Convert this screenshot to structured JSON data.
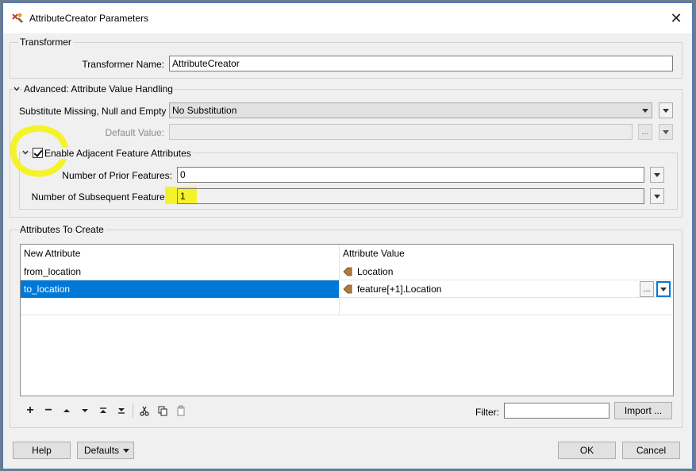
{
  "window": {
    "title": "AttributeCreator Parameters",
    "close_glyph": "✕"
  },
  "transformer": {
    "group_title": "Transformer",
    "name_label": "Transformer Name:",
    "name_value": "AttributeCreator"
  },
  "advanced": {
    "group_title": "Advanced: Attribute Value Handling",
    "substitute_label": "Substitute Missing, Null and Empty by:",
    "substitute_value": "No Substitution",
    "default_label": "Default Value:",
    "default_value": "",
    "ellipsis": "...",
    "adjacent": {
      "checkbox_label": "Enable Adjacent Feature Attributes",
      "checked": true,
      "prior_label": "Number of Prior Features:",
      "prior_value": "0",
      "subsequent_label": "Number of Subsequent Features:",
      "subsequent_value": "1"
    }
  },
  "attributes": {
    "group_title": "Attributes To Create",
    "columns": [
      "New Attribute",
      "Attribute Value"
    ],
    "rows": [
      {
        "name": "from_location",
        "value": "Location"
      },
      {
        "name": "to_location",
        "value": "feature[+1].Location"
      }
    ],
    "cell_ellipsis": "...",
    "selected_row": 1
  },
  "toolbar": {
    "filter_label": "Filter:",
    "filter_value": "",
    "import_label": "Import ...",
    "tools": [
      "add-icon",
      "remove-icon",
      "move-up-icon",
      "move-down-icon",
      "move-top-icon",
      "move-bottom-icon",
      "cut-icon",
      "copy-icon",
      "paste-icon"
    ]
  },
  "footer": {
    "help_label": "Help",
    "defaults_label": "Defaults",
    "ok_label": "OK",
    "cancel_label": "Cancel"
  },
  "colors": {
    "selection": "#0078d7",
    "highlight": "#f4f32a",
    "accent_border": "#4a7ab6"
  }
}
